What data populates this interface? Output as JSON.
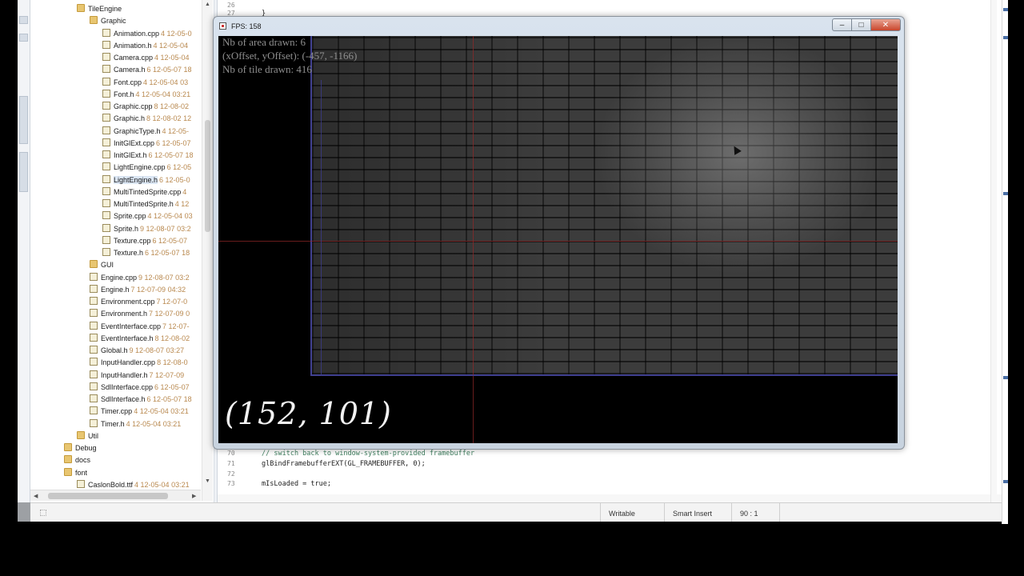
{
  "explorer": {
    "items": [
      {
        "name": "TileEngine",
        "kind": "folder",
        "meta": ""
      },
      {
        "name": "Graphic",
        "kind": "folder",
        "meta": ""
      },
      {
        "name": "Animation.cpp",
        "kind": "file",
        "meta": "4  12-05-0"
      },
      {
        "name": "Animation.h",
        "kind": "file",
        "meta": "4  12-05-04"
      },
      {
        "name": "Camera.cpp",
        "kind": "file",
        "meta": "4  12-05-04"
      },
      {
        "name": "Camera.h",
        "kind": "file",
        "meta": "6  12-05-07 18"
      },
      {
        "name": "Font.cpp",
        "kind": "file",
        "meta": "4  12-05-04 03"
      },
      {
        "name": "Font.h",
        "kind": "file",
        "meta": "4  12-05-04 03:21"
      },
      {
        "name": "Graphic.cpp",
        "kind": "file",
        "meta": "8  12-08-02"
      },
      {
        "name": "Graphic.h",
        "kind": "file",
        "meta": "8  12-08-02 12"
      },
      {
        "name": "GraphicType.h",
        "kind": "file",
        "meta": "4  12-05-"
      },
      {
        "name": "InitGlExt.cpp",
        "kind": "file",
        "meta": "6  12-05-07"
      },
      {
        "name": "InitGlExt.h",
        "kind": "file",
        "meta": "6  12-05-07 18"
      },
      {
        "name": "LightEngine.cpp",
        "kind": "file",
        "meta": "6  12-05"
      },
      {
        "name": "LightEngine.h",
        "kind": "file",
        "meta": "6  12-05-0"
      },
      {
        "name": "MultiTintedSprite.cpp",
        "kind": "file",
        "meta": "4"
      },
      {
        "name": "MultiTintedSprite.h",
        "kind": "file",
        "meta": "4  12"
      },
      {
        "name": "Sprite.cpp",
        "kind": "file",
        "meta": "4  12-05-04 03"
      },
      {
        "name": "Sprite.h",
        "kind": "file",
        "meta": "9  12-08-07 03:2"
      },
      {
        "name": "Texture.cpp",
        "kind": "file",
        "meta": "6  12-05-07"
      },
      {
        "name": "Texture.h",
        "kind": "file",
        "meta": "6  12-05-07 18"
      },
      {
        "name": "GUI",
        "kind": "folder",
        "meta": ""
      },
      {
        "name": "Engine.cpp",
        "kind": "file",
        "meta": "9  12-08-07 03:2"
      },
      {
        "name": "Engine.h",
        "kind": "file",
        "meta": "7  12-07-09 04:32"
      },
      {
        "name": "Environment.cpp",
        "kind": "file",
        "meta": "7  12-07-0"
      },
      {
        "name": "Environment.h",
        "kind": "file",
        "meta": "7  12-07-09 0"
      },
      {
        "name": "EventInterface.cpp",
        "kind": "file",
        "meta": "7  12-07-"
      },
      {
        "name": "EventInterface.h",
        "kind": "file",
        "meta": "8  12-08-02"
      },
      {
        "name": "Global.h",
        "kind": "file",
        "meta": "9  12-08-07 03:27"
      },
      {
        "name": "InputHandler.cpp",
        "kind": "file",
        "meta": "8  12-08-0"
      },
      {
        "name": "InputHandler.h",
        "kind": "file",
        "meta": "7  12-07-09"
      },
      {
        "name": "SdlInterface.cpp",
        "kind": "file",
        "meta": "6  12-05-07"
      },
      {
        "name": "SdlInterface.h",
        "kind": "file",
        "meta": "6  12-05-07 18"
      },
      {
        "name": "Timer.cpp",
        "kind": "file",
        "meta": "4  12-05-04 03:21"
      },
      {
        "name": "Timer.h",
        "kind": "file",
        "meta": "4  12-05-04 03:21"
      },
      {
        "name": "Util",
        "kind": "folder",
        "meta": ""
      },
      {
        "name": "Debug",
        "kind": "folder",
        "meta": ""
      },
      {
        "name": "docs",
        "kind": "folder",
        "meta": ""
      },
      {
        "name": "font",
        "kind": "folder",
        "meta": ""
      },
      {
        "name": "CaslonBold.ttf",
        "kind": "file",
        "meta": "4  12-05-04 03:21"
      }
    ],
    "selected_index": 14
  },
  "editor": {
    "top_line_numbers": [
      "26",
      "27"
    ],
    "top_code": [
      "",
      "}"
    ],
    "bottom_lines": [
      {
        "num": "70",
        "code": "// switch back to window-system-provided framebuffer",
        "comment": true
      },
      {
        "num": "71",
        "code": "glBindFramebufferEXT(GL_FRAMEBUFFER, 0);",
        "comment": false
      },
      {
        "num": "72",
        "code": "",
        "comment": false
      },
      {
        "num": "73",
        "code": "mIsLoaded = true;",
        "comment": false
      }
    ]
  },
  "statusbar": {
    "writable": "Writable",
    "insert_mode": "Smart Insert",
    "position": "90 : 1"
  },
  "game_window": {
    "title": "FPS: 158",
    "hud": {
      "line1": "Nb of area drawn: 6",
      "line2": "(xOffset, yOffset): (-457, -1166)",
      "line3": "Nb of tile drawn: 416"
    },
    "coords_overlay": "(152, 101)",
    "caption_minimize": "–",
    "caption_maximize": "□",
    "caption_close": "✕"
  },
  "colors": {
    "hud_text": "#8f8f8f",
    "overlay_text": "#f2f2f2",
    "guide_red": "#962828",
    "guide_blue": "#404090"
  }
}
